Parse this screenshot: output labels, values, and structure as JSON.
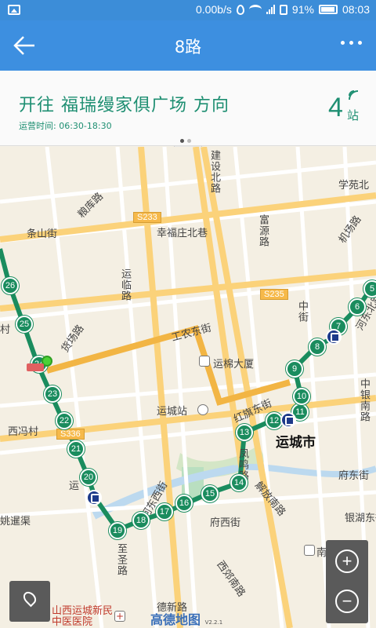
{
  "status_bar": {
    "net_speed": "0.00b/s",
    "battery": "91%",
    "time": "08:03",
    "net_type": "4G"
  },
  "app_bar": {
    "title": "8路"
  },
  "route_info": {
    "direction": "开往 福瑞缦家俱广场 方向",
    "hours_label": "运营时间:",
    "hours": "06:30-18:30",
    "eta_count": "4",
    "eta_unit": "站"
  },
  "map": {
    "labels": {
      "xueyuan_north": "学苑北",
      "liangku": "粮库路",
      "tiaoshan": "条山街",
      "xingfu": "幸福庄北巷",
      "fuyuan": "富源路",
      "jichang": "机场路",
      "yuandong": "运临路",
      "huowu": "货场路",
      "gongnong": "工农东街",
      "yunmian": "运棉大厦",
      "yuncheng_station": "运城站",
      "ximalu": "西冯村",
      "hedong": "河东西街",
      "fengming": "凤鸣路",
      "jiefang": "解放南路",
      "fuxi": "府西街",
      "fudong": "府东街",
      "yinhu": "银湖东街",
      "nanfeng": "南风学院",
      "xiye": "西郊南路",
      "desheng": "德新路",
      "zhisheng": "至圣路",
      "yao": "姚暹渠",
      "hospital": "山西运城新民中医医院",
      "zhongyin": "中银南路",
      "hedong_n": "河东北路",
      "jiandong": "建设北路",
      "jing": "红旗东街",
      "yun": "运",
      "cun": "村",
      "zhongzhong": "中街"
    },
    "road_tags": [
      "S233",
      "S235",
      "S336"
    ],
    "city_label": "运城市",
    "stops": [
      "26",
      "25",
      "24",
      "23",
      "22",
      "21",
      "20",
      "19",
      "18",
      "17",
      "16",
      "15",
      "14",
      "13",
      "12",
      "11",
      "10",
      "9",
      "8",
      "7",
      "6",
      "5"
    ],
    "logo_text": "高德地图",
    "logo_version": "V2.2.1"
  }
}
